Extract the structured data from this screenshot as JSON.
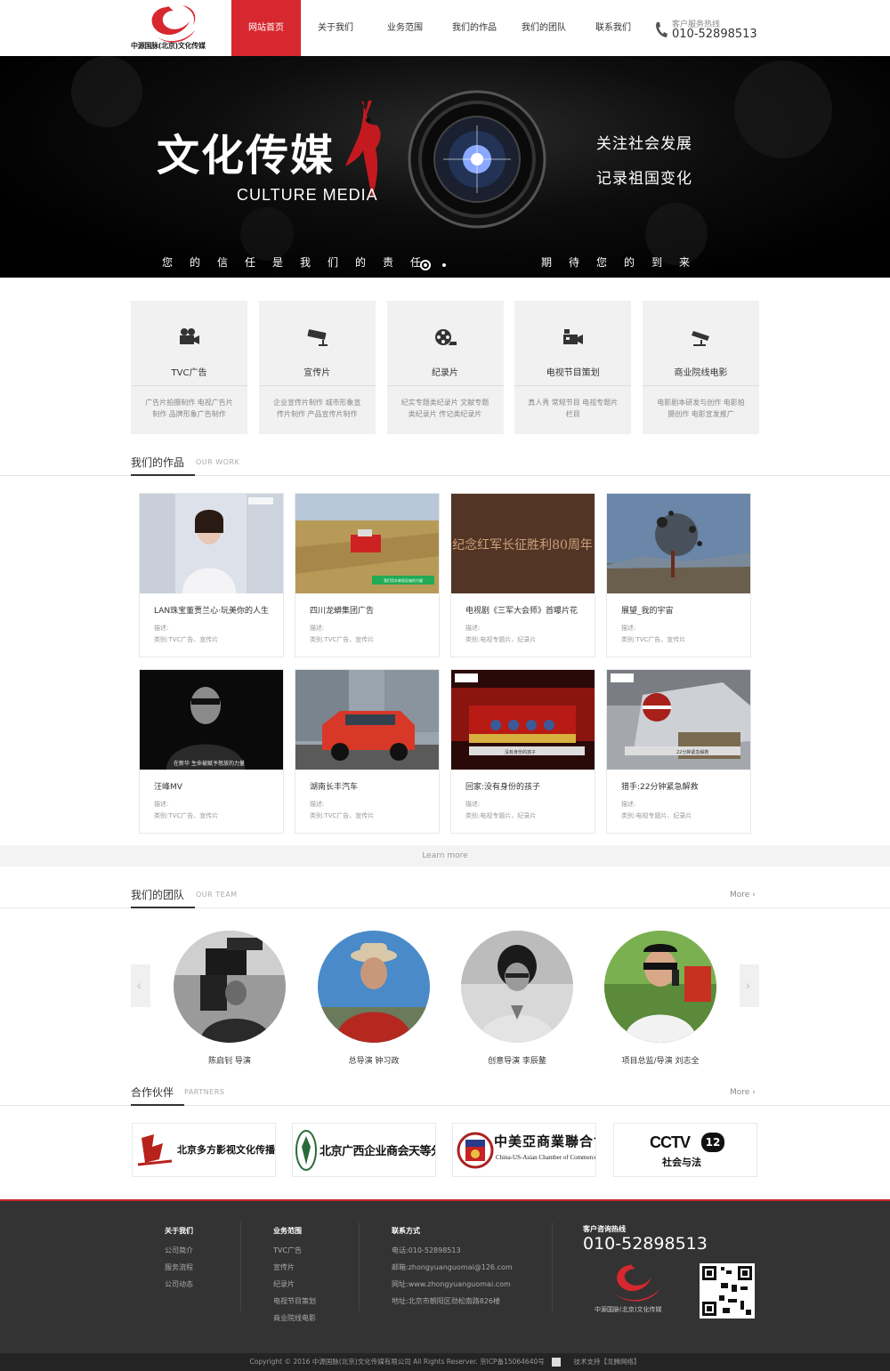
{
  "header": {
    "logo_text": "中源国脉(北京)文化传媒",
    "nav": [
      {
        "label": "网站首页",
        "active": true
      },
      {
        "label": "关于我们"
      },
      {
        "label": "业务范围"
      },
      {
        "label": "我们的作品"
      },
      {
        "label": "我们的团队"
      },
      {
        "label": "联系我们"
      }
    ],
    "hotline_label": "客户服务热线",
    "hotline_number": "010-52898513"
  },
  "banner": {
    "title": "文化传媒",
    "subtitle": "CULTURE MEDIA",
    "slogan1": "关注社会发展",
    "slogan2": "记录祖国变化",
    "bottom_left": "您的信任是我们的责任",
    "bottom_right": "期待您的到来",
    "slides": 2,
    "active_slide": 1
  },
  "services": [
    {
      "title": "TVC广告",
      "icon": "movie-camera-icon",
      "desc": "广告片拍摄制作 电视广告片制作 品牌形象广告制作"
    },
    {
      "title": "宣传片",
      "icon": "security-camera-icon",
      "desc": "企业宣传片制作 城市形象宣传片制作 产品宣传片制作"
    },
    {
      "title": "纪录片",
      "icon": "film-reel-icon",
      "desc": "纪实专题类纪录片 文献专题类纪录片 传记类纪录片"
    },
    {
      "title": "电视节目策划",
      "icon": "video-camera-icon",
      "desc": "真人秀 常规节目 电视专题片栏目"
    },
    {
      "title": "商业院线电影",
      "icon": "cctv-camera-icon",
      "desc": "电影剧本研发与创作 电影拍摄创作 电影宣发推广"
    }
  ],
  "works_section": {
    "title": "我们的作品",
    "en": "OUR WORK"
  },
  "works": [
    {
      "title": "LAN珠宝董贾兰心·玩美你的人生",
      "desc": "描述:",
      "cat": "类别:TVC广告、宣传片",
      "scene": "woman"
    },
    {
      "title": "四川龙蟒集团广告",
      "desc": "描述:",
      "cat": "类别:TVC广告、宣传片",
      "scene": "harvest",
      "caption": "我们用丰收验证她的力量"
    },
    {
      "title": "电视剧《三军大会师》首曝片花",
      "desc": "描述:",
      "cat": "类别:电视专题片、纪录片",
      "scene": "wall",
      "caption": "纪念红军长征胜利80周年"
    },
    {
      "title": "展望_我的宇宙",
      "desc": "描述:",
      "cat": "类别:TVC广告、宣传片",
      "scene": "explosion"
    },
    {
      "title": "汪峰MV",
      "desc": "描述:",
      "cat": "类别:TVC广告、宣传片",
      "scene": "singer",
      "caption": "在新华 生命被赋予怒放的力量"
    },
    {
      "title": "湖南长丰汽车",
      "desc": "描述:",
      "cat": "类别:TVC广告、宣传片",
      "scene": "car"
    },
    {
      "title": "回家:没有身份的孩子",
      "desc": "描述:",
      "cat": "类别:电视专题片、纪录片",
      "scene": "stage",
      "caption": "没有身份的孩子"
    },
    {
      "title": "猎手:22分钟紧急解救",
      "desc": "描述:",
      "cat": "类别:电视专题片、纪录片",
      "scene": "police",
      "caption": "22分钟紧急解救"
    }
  ],
  "learn_more": "Learn more",
  "team_section": {
    "title": "我们的团队",
    "en": "OUR TEAM",
    "more": "More"
  },
  "team": [
    {
      "name": "陈启钊 导演",
      "scene": "cameraman"
    },
    {
      "name": "总导演 钟习政",
      "scene": "hat"
    },
    {
      "name": "创意导演 李辰鳌",
      "scene": "pray"
    },
    {
      "name": "项目总监/导演 刘志全",
      "scene": "phone"
    }
  ],
  "partners_section": {
    "title": "合作伙伴",
    "en": "PARTNERS",
    "more": "More"
  },
  "partners": [
    {
      "name": "北京多方影视文化传播中心"
    },
    {
      "name": "北京广西企业商会天等分会"
    },
    {
      "name": "中美亞商業聯合會",
      "sub": "China-US-Asian Chamber of Commerce"
    },
    {
      "name": "社会与法",
      "badge": "CCTV",
      "channel": "12"
    }
  ],
  "footer": {
    "col1": {
      "title": "关于我们",
      "items": [
        "公司简介",
        "服务流程",
        "公司动态"
      ]
    },
    "col2": {
      "title": "业务范围",
      "items": [
        "TVC广告",
        "宣传片",
        "纪录片",
        "电视节目策划",
        "商业院线电影"
      ]
    },
    "col3": {
      "title": "联系方式",
      "items": [
        "电话:010-52898513",
        "邮箱:zhongyuanguomai@126.com",
        "网址:www.zhongyuanguomai.com",
        "地址:北京市朝阳区劲松南路826楼"
      ]
    },
    "hotline_label": "客户咨询热线",
    "hotline_number": "010-52898513",
    "logo_text": "中源国脉(北京)文化传媒"
  },
  "copyright": "Copyright © 2016 中源国脉(北京)文化传媒有限公司 All Rights Reserver.  京ICP备15064640号",
  "support": "技术支持【龙腾网络】",
  "colors": {
    "accent": "#d7282f",
    "footer_bg": "#333333"
  }
}
